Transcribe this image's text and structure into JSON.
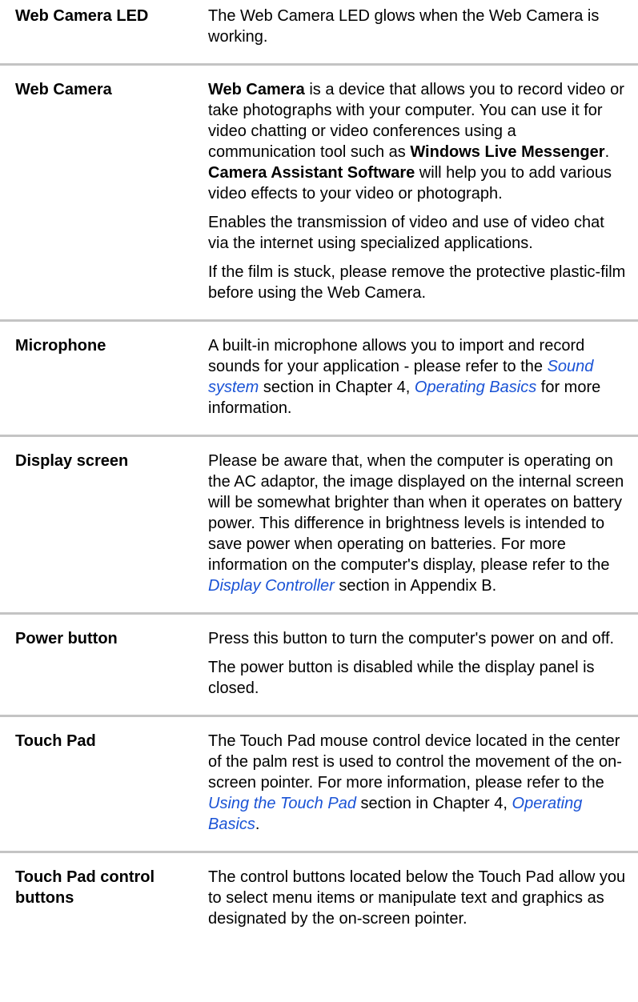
{
  "rows": [
    {
      "term": "Web Camera LED",
      "paras": [
        {
          "text": "The Web Camera LED glows when the Web Camera is working."
        }
      ]
    },
    {
      "term": "Web Camera",
      "paras": [
        {
          "s1": "Web Camera",
          "s2": " is a device that allows you to record video or take photographs with your computer. You can use it for video chatting or video conferences using a communication tool such as ",
          "s3": "Windows Live Messenger",
          "s4": ". ",
          "s5": "Camera Assistant Software",
          "s6": " will help you to add various video effects to your video or photograph."
        },
        {
          "text": "Enables the transmission of video and use of video chat via the internet using specialized applications."
        },
        {
          "text": "If the film is stuck, please remove the protective plastic-film before using the Web Camera."
        }
      ]
    },
    {
      "term": "Microphone",
      "paras": [
        {
          "s1": "A built-in microphone allows you to import and record sounds for your application - please refer to the ",
          "l1": "Sound system",
          "s2": " section in Chapter 4, ",
          "l2": "Operating Basics",
          "s3": " for more information."
        }
      ]
    },
    {
      "term": "Display screen",
      "paras": [
        {
          "s1": "Please be aware that, when the computer is operating on the AC adaptor, the image displayed on the internal screen will be somewhat brighter than when it operates on battery power. This difference in brightness levels is intended to save power when operating on batteries. For more information on the computer's display, please refer to the ",
          "l1": "Display Controller",
          "s2": " section in Appendix B."
        }
      ]
    },
    {
      "term": "Power button",
      "paras": [
        {
          "text": "Press this button to turn the computer's power on and off."
        },
        {
          "text": "The power button is disabled while the display panel is closed."
        }
      ]
    },
    {
      "term": "Touch Pad",
      "paras": [
        {
          "s1": "The Touch Pad mouse control device located in the center of the palm rest is used to control the movement of the on-screen pointer. For more information, please refer to the ",
          "l1": "Using the Touch Pad",
          "s2": " section in Chapter 4, ",
          "l2": "Operating Basics",
          "s3": "."
        }
      ]
    },
    {
      "term": "Touch Pad control buttons",
      "paras": [
        {
          "text": "The control buttons located below the Touch Pad allow you to select menu items or manipulate text and graphics as designated by the on-screen pointer."
        }
      ]
    }
  ],
  "colors": {
    "link": "#1a53d6",
    "separator": "#c4c4c4",
    "text": "#000000"
  }
}
